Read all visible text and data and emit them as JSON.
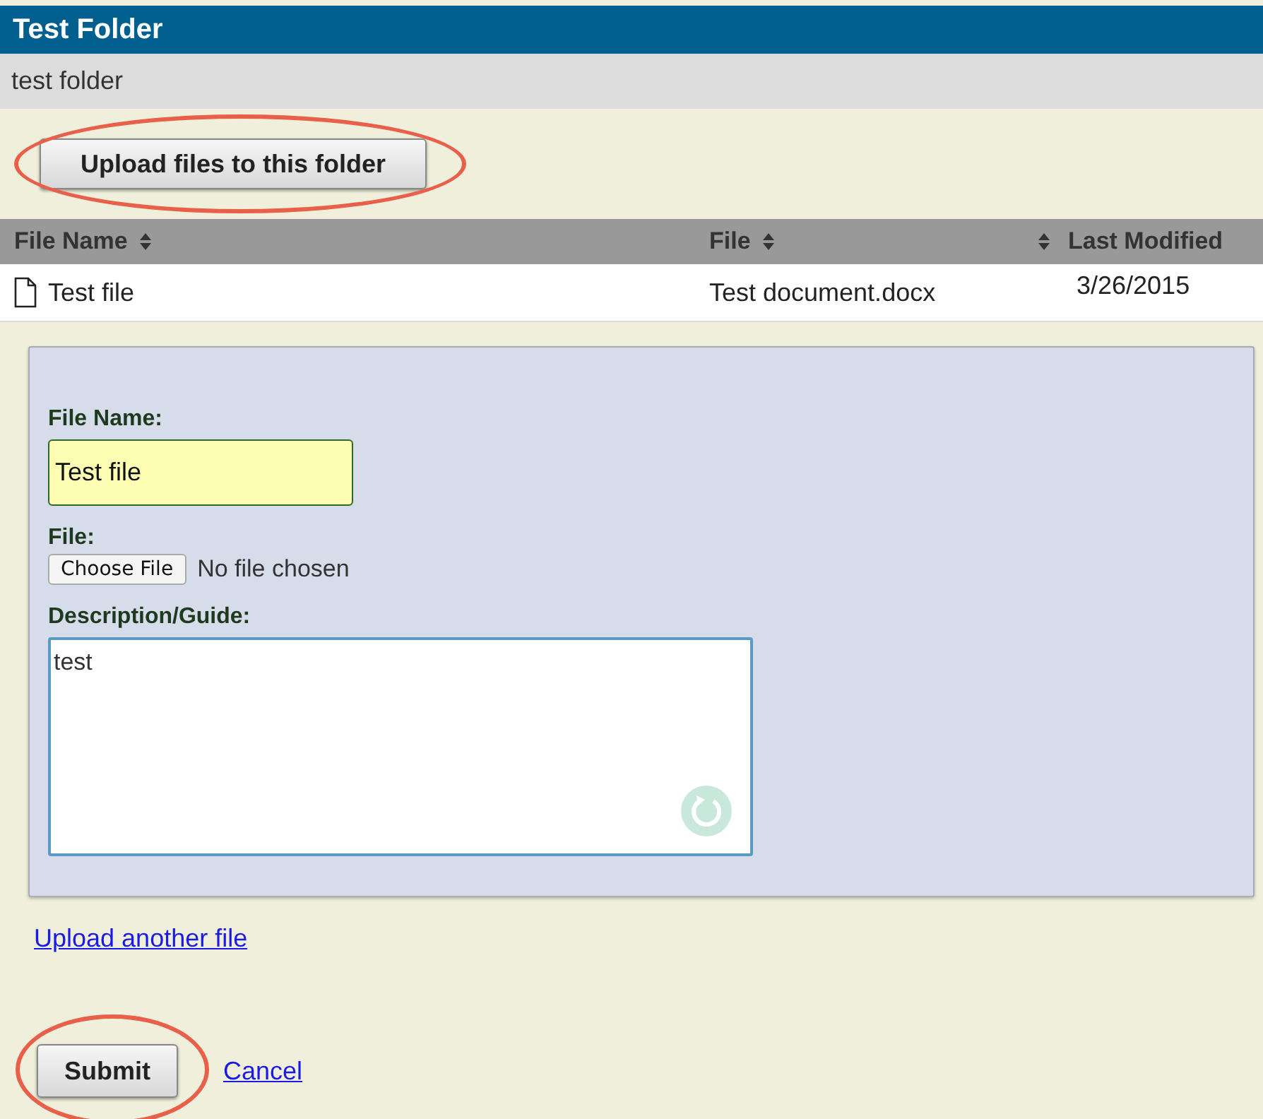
{
  "header": {
    "title": "Test Folder",
    "subtitle": "test folder"
  },
  "upload_button": "Upload files to this folder",
  "table": {
    "columns": [
      {
        "label": "File Name",
        "sort_before": false
      },
      {
        "label": "File",
        "sort_before": false
      },
      {
        "label": "Last Modified",
        "sort_before": true
      }
    ],
    "rows": [
      {
        "name": "Test file",
        "file": "Test document.docx",
        "modified": "3/26/2015"
      }
    ]
  },
  "form": {
    "name_label": "File Name:",
    "name_value": "Test file",
    "file_label": "File:",
    "choose_button": "Choose File",
    "file_status": "No file chosen",
    "description_label": "Description/Guide:",
    "description_value": "test"
  },
  "upload_another_link": "Upload another file",
  "submit_button": "Submit",
  "cancel_link": "Cancel"
}
